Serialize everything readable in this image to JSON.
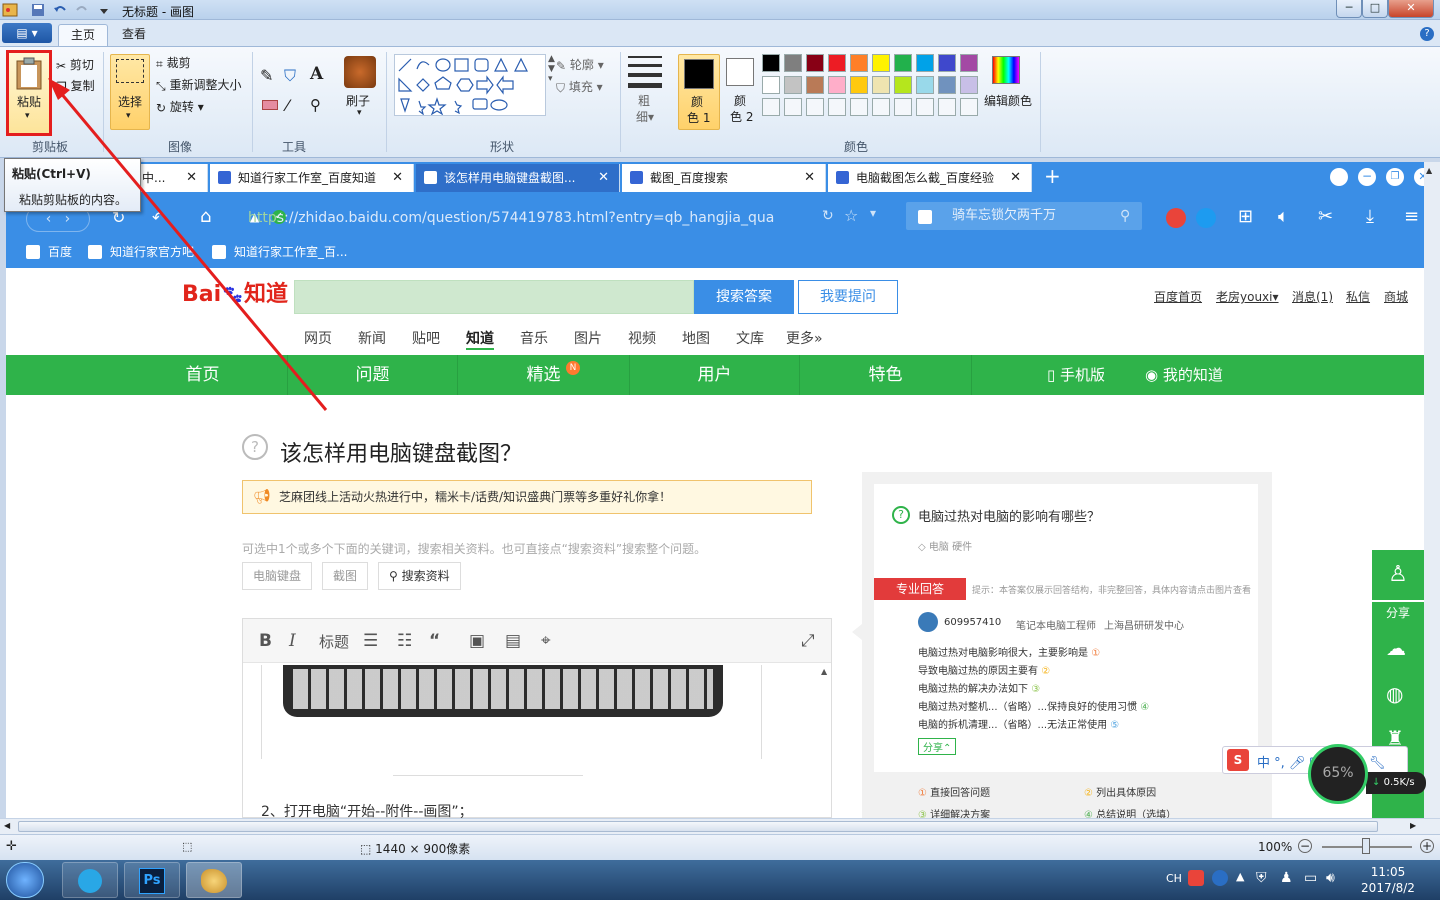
{
  "window": {
    "title": "无标题 - 画图",
    "minimize": "─",
    "maximize": "□",
    "close": "✕"
  },
  "ribbon": {
    "app_menu": "▤",
    "tabs": [
      "主页",
      "查看"
    ],
    "clipboard": {
      "paste": "粘贴",
      "cut": "剪切",
      "copy": "复制",
      "label": "剪贴板"
    },
    "image": {
      "select": "选择",
      "crop": "裁剪",
      "resize": "重新调整大小",
      "rotate": "旋转",
      "label": "图像"
    },
    "tools": {
      "label": "工具",
      "brush": "刷子"
    },
    "shapes": {
      "outline": "轮廓",
      "fill": "填充",
      "label": "形状"
    },
    "size": {
      "line1": "粗",
      "line2": "细"
    },
    "colors": {
      "color1_a": "颜",
      "color1_b": "色 1",
      "color2_a": "颜",
      "color2_b": "色 2",
      "edit": "编辑颜色",
      "label": "颜色",
      "palette_row1": [
        "#000000",
        "#7f7f7f",
        "#880015",
        "#ed1c24",
        "#ff7f27",
        "#fff200",
        "#22b14c",
        "#00a2e8",
        "#3f48cc",
        "#a349a4"
      ],
      "palette_row2": [
        "#ffffff",
        "#c3c3c3",
        "#b97a57",
        "#ffaec9",
        "#ffc90e",
        "#efe4b0",
        "#b5e61d",
        "#99d9ea",
        "#7092be",
        "#c8bfe7"
      ]
    }
  },
  "tooltip": {
    "title": "粘贴(Ctrl+V)",
    "desc": "粘贴剪贴板的内容。"
  },
  "browser": {
    "tabs": [
      {
        "label": "中...",
        "close": "✕"
      },
      {
        "label": "知道行家工作室_百度知道",
        "close": "✕"
      },
      {
        "label": "该怎样用电脑键盘截图...",
        "close": "✕"
      },
      {
        "label": "截图_百度搜索",
        "close": "✕"
      },
      {
        "label": "电脑截图怎么截_百度经验",
        "close": "✕"
      }
    ],
    "new_tab": "+",
    "url_prefix": "http",
    "url": "s://zhidao.baidu.com/question/574419783.html?entry=qb_hangjia_qua",
    "search_placeholder": "骑车忘锁欠两千万",
    "bookmarks": [
      "百度",
      "知道行家官方吧",
      "知道行家工作室_百..."
    ]
  },
  "page": {
    "logo_a": "Bai",
    "logo_b": "知道",
    "search_answer": "搜索答案",
    "ask": "我要提问",
    "top_links": [
      "百度首页",
      "老房youxi",
      "消息(1)",
      "私信",
      "商城"
    ],
    "nav_links": [
      "网页",
      "新闻",
      "贴吧",
      "知道",
      "音乐",
      "图片",
      "视频",
      "地图",
      "文库",
      "更多»"
    ],
    "green_nav": [
      "首页",
      "问题",
      "精选",
      "用户",
      "特色",
      "手机版",
      "我的知道"
    ],
    "new_badge": "N",
    "question_title": "该怎样用电脑键盘截图？",
    "notice": "芝麻团线上活动火热进行中，糯米卡/话费/知识盛典门票等多重好礼你拿！",
    "hint": "可选中1个或多个下面的关键词，搜索相关资料。也可直接点“搜索资料”搜索整个问题。",
    "tags": [
      "电脑键盘",
      "截图"
    ],
    "search_material": "搜索资料",
    "editor_tools": [
      "B",
      "I",
      "标题"
    ],
    "step_text": "2、打开电脑“开始--附件--画图”；",
    "side_question": "电脑过热对电脑的影响有哪些？",
    "side_tags": "电脑  硬件",
    "pro_answer": "专业回答",
    "pro_hint": "提示：本答案仅展示回答结构，非完整回答，具体内容请点击图片查看",
    "answerer": "609957410",
    "answerer_role": "笔记本电脑工程师",
    "answerer_org": "上海昌研研发中心",
    "answer_lines": [
      "电脑过热对电脑影响很大，主要影响是",
      "导致电脑过热的原因主要有",
      "电脑过热的解决办法如下",
      "电脑过热对整机...（省略）...保持良好的使用习惯",
      "电脑的拆机清理...（省略）...无法正常使用"
    ],
    "share_small": "分享",
    "legend": [
      "直接回答问题",
      "列出具体原因",
      "详细解决方案",
      "总结说明（选填）"
    ],
    "side_share": "分享",
    "speed": "0.5K/s",
    "percent": "65%"
  },
  "status": {
    "dimensions": "1440 × 900像素",
    "zoom": "100%"
  },
  "taskbar": {
    "lang": "CH",
    "time": "11:05",
    "date": "2017/8/2"
  }
}
